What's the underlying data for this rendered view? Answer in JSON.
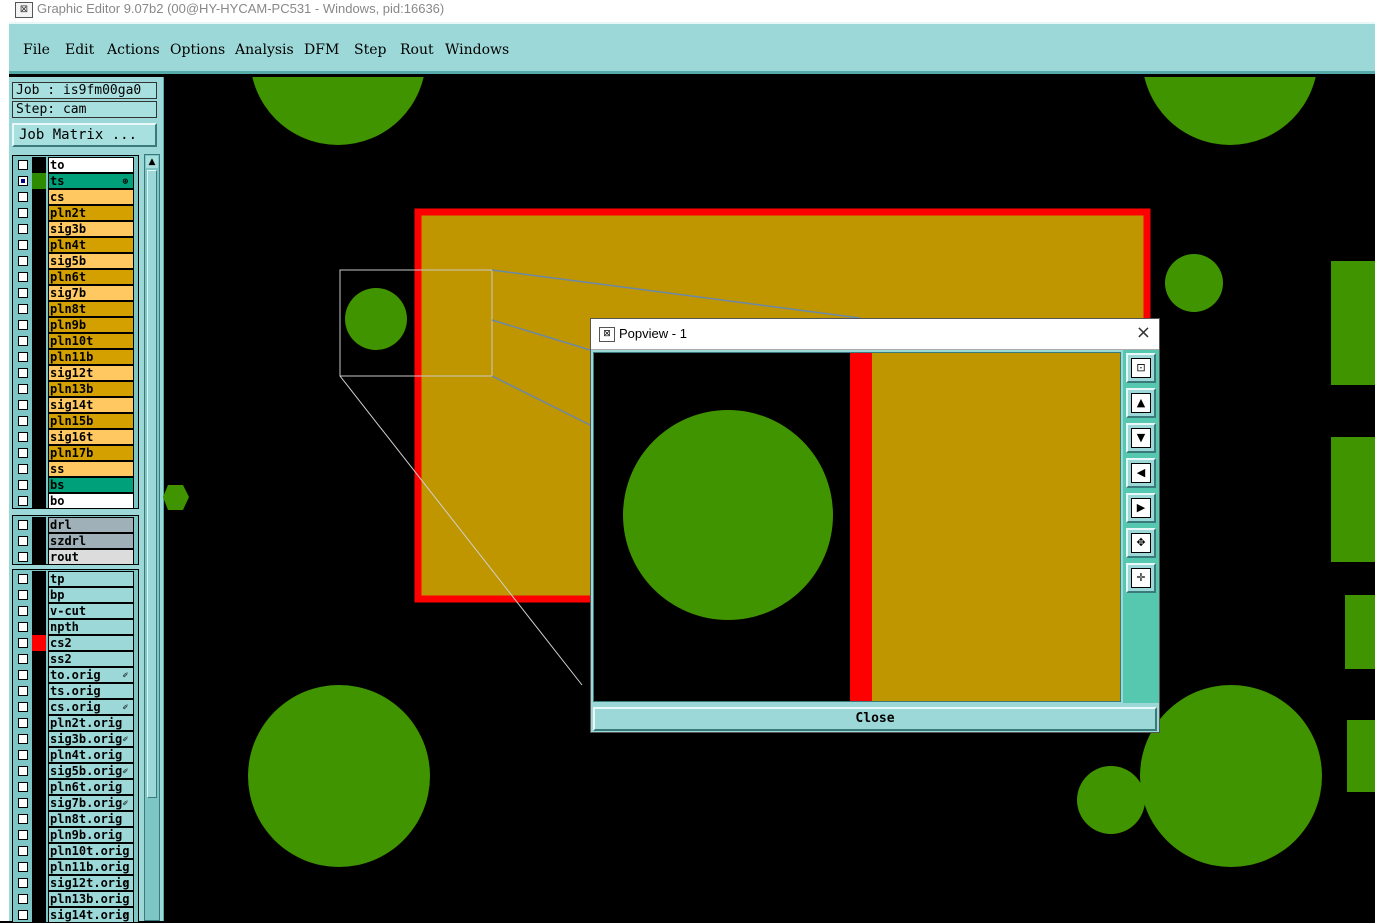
{
  "window": {
    "title": "Graphic Editor 9.07b2 (00@HY-HYCAM-PC531 - Windows, pid:16636)",
    "icon": "app-icon"
  },
  "menu": [
    {
      "label": "File"
    },
    {
      "label": "Edit"
    },
    {
      "label": "Actions"
    },
    {
      "label": "Options"
    },
    {
      "label": "Analysis"
    },
    {
      "label": "DFM"
    },
    {
      "label": "Step"
    },
    {
      "label": "Rout"
    },
    {
      "label": "Windows"
    }
  ],
  "panel": {
    "job": "Job : is9fm00ga0",
    "step": "Step: cam",
    "job_matrix": "Job Matrix ..."
  },
  "layers": {
    "board": [
      {
        "name": "to",
        "color": "#ffffff",
        "swatch": "#000000"
      },
      {
        "name": "ts",
        "color": "#00a07a",
        "swatch": "#2e8b00",
        "selected": true,
        "mark": "⊕"
      },
      {
        "name": "cs",
        "color": "#ffc860"
      },
      {
        "name": "pln2t",
        "color": "#d4a000"
      },
      {
        "name": "sig3b",
        "color": "#ffc860"
      },
      {
        "name": "pln4t",
        "color": "#d4a000"
      },
      {
        "name": "sig5b",
        "color": "#ffc860"
      },
      {
        "name": "pln6t",
        "color": "#d4a000"
      },
      {
        "name": "sig7b",
        "color": "#ffc860"
      },
      {
        "name": "pln8t",
        "color": "#d4a000"
      },
      {
        "name": "pln9b",
        "color": "#d4a000"
      },
      {
        "name": "pln10t",
        "color": "#d4a000"
      },
      {
        "name": "pln11b",
        "color": "#d4a000"
      },
      {
        "name": "sig12t",
        "color": "#ffc860"
      },
      {
        "name": "pln13b",
        "color": "#d4a000"
      },
      {
        "name": "sig14t",
        "color": "#ffc860"
      },
      {
        "name": "pln15b",
        "color": "#d4a000"
      },
      {
        "name": "sig16t",
        "color": "#ffc860"
      },
      {
        "name": "pln17b",
        "color": "#d4a000"
      },
      {
        "name": "ss",
        "color": "#ffc860"
      },
      {
        "name": "bs",
        "color": "#00a07a"
      },
      {
        "name": "bo",
        "color": "#ffffff"
      }
    ],
    "drill": [
      {
        "name": "drl",
        "color": "#a0b0b8"
      },
      {
        "name": "szdrl",
        "color": "#a0b0b8"
      },
      {
        "name": "rout",
        "color": "#dcdcdc"
      }
    ],
    "misc": [
      {
        "name": "tp",
        "color": "#9dd8d8"
      },
      {
        "name": "bp",
        "color": "#9dd8d8"
      },
      {
        "name": "v-cut",
        "color": "#9dd8d8"
      },
      {
        "name": "npth",
        "color": "#9dd8d8"
      },
      {
        "name": "cs2",
        "color": "#9dd8d8",
        "swatch": "#ff0000"
      },
      {
        "name": "ss2",
        "color": "#9dd8d8"
      },
      {
        "name": "to.orig",
        "color": "#9dd8d8",
        "mark": "✐"
      },
      {
        "name": "ts.orig",
        "color": "#9dd8d8"
      },
      {
        "name": "cs.orig",
        "color": "#9dd8d8",
        "mark": "✐"
      },
      {
        "name": "pln2t.orig",
        "color": "#9dd8d8"
      },
      {
        "name": "sig3b.orig",
        "color": "#9dd8d8",
        "mark": "✐"
      },
      {
        "name": "pln4t.orig",
        "color": "#9dd8d8"
      },
      {
        "name": "sig5b.orig",
        "color": "#9dd8d8",
        "mark": "✐"
      },
      {
        "name": "pln6t.orig",
        "color": "#9dd8d8"
      },
      {
        "name": "sig7b.orig",
        "color": "#9dd8d8",
        "mark": "✐"
      },
      {
        "name": "pln8t.orig",
        "color": "#9dd8d8"
      },
      {
        "name": "pln9b.orig",
        "color": "#9dd8d8"
      },
      {
        "name": "pln10t.orig",
        "color": "#9dd8d8"
      },
      {
        "name": "pln11b.orig",
        "color": "#9dd8d8"
      },
      {
        "name": "sig12t.orig",
        "color": "#9dd8d8",
        "mark": "✐"
      },
      {
        "name": "pln13b.orig",
        "color": "#9dd8d8"
      },
      {
        "name": "sig14t.orig",
        "color": "#9dd8d8",
        "mark": "✐"
      }
    ]
  },
  "popview": {
    "title": "Popview - 1",
    "close_label": "Close",
    "close_icon": "×",
    "tools": [
      {
        "icon": "zoom-fit-icon",
        "glyph": "⊡"
      },
      {
        "icon": "pan-up-icon",
        "glyph": "▲"
      },
      {
        "icon": "pan-down-icon",
        "glyph": "▼"
      },
      {
        "icon": "pan-left-icon",
        "glyph": "◀"
      },
      {
        "icon": "pan-right-icon",
        "glyph": "▶"
      },
      {
        "icon": "zoom-in-icon",
        "glyph": "✥"
      },
      {
        "icon": "zoom-out-icon",
        "glyph": "✛"
      }
    ]
  },
  "colors": {
    "panel": "#9dd8d8",
    "pad": "#3f9400",
    "copper": "#bf9600",
    "outline": "#ff0000"
  }
}
